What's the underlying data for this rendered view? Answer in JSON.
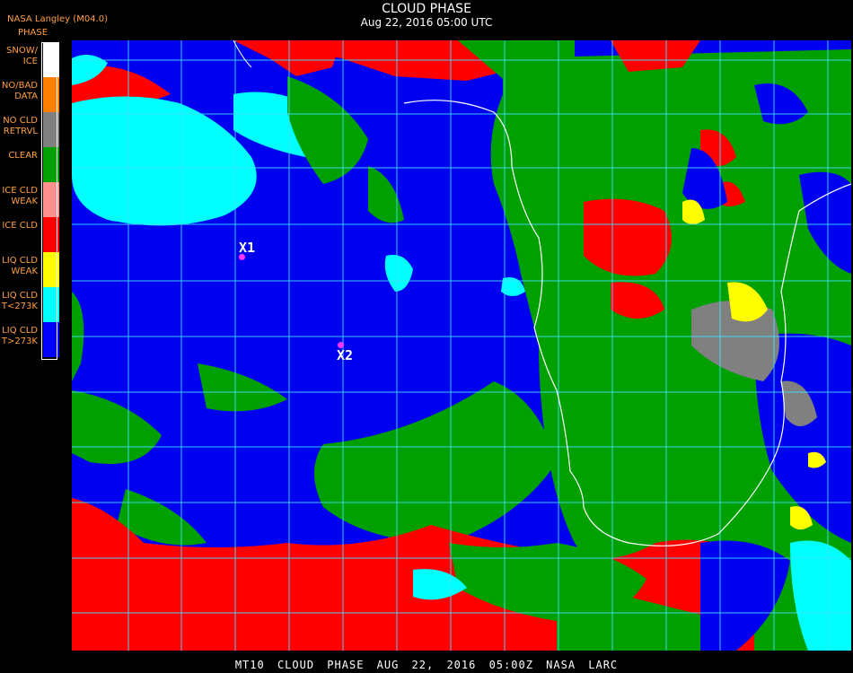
{
  "header": {
    "title": "CLOUD PHASE",
    "date": "Aug 22, 2016 05:00 UTC",
    "source": "NASA Langley (M04.0)"
  },
  "legend": {
    "title": "PHASE",
    "items": [
      {
        "label": "SNOW/\nICE",
        "color": "#ffffff"
      },
      {
        "label": "NO/BAD\nDATA",
        "color": "#ff8000"
      },
      {
        "label": "NO CLD\nRETRVL",
        "color": "#808080"
      },
      {
        "label": "CLEAR",
        "color": "#00a000"
      },
      {
        "label": "ICE CLD\nWEAK",
        "color": "#ff9090"
      },
      {
        "label": "ICE CLD",
        "color": "#ff0000"
      },
      {
        "label": "LIQ CLD\nWEAK",
        "color": "#ffff00"
      },
      {
        "label": "LIQ CLD\nT<273K",
        "color": "#00ffff"
      },
      {
        "label": "LIQ CLD\nT>273K",
        "color": "#0000ff"
      }
    ]
  },
  "markers": [
    {
      "label": "X1"
    },
    {
      "label": "X2"
    }
  ],
  "footer": "MT10 CLOUD PHASE AUG 22, 2016 05:00Z NASA LARC",
  "colors": {
    "grid": "#40e0ff",
    "coastline": "#ffffff",
    "marker": "#ff33ff",
    "label_text": "#ffa040"
  }
}
